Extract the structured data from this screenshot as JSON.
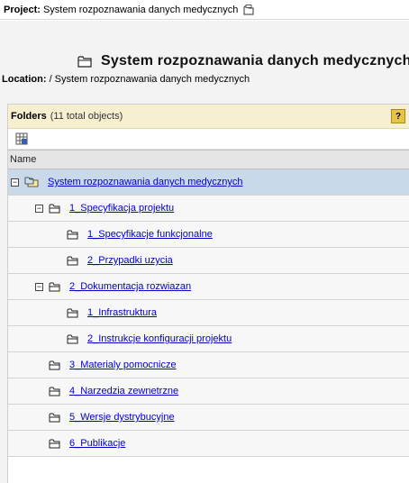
{
  "project": {
    "label": "Project:",
    "name": "System rozpoznawania danych medycznych"
  },
  "header": {
    "title": "System rozpoznawania danych medycznych"
  },
  "location": {
    "label": "Location:",
    "path": "/ System rozpoznawania danych medycznych"
  },
  "panel": {
    "title": "Folders",
    "count": "(11 total objects)",
    "help": "?"
  },
  "table": {
    "column_name": "Name"
  },
  "tree": [
    {
      "label": "System rozpoznawania danych medycznych",
      "toggle": "−"
    },
    {
      "label": "1_Specyfikacja projektu",
      "toggle": "−"
    },
    {
      "label": "1_Specyfikacje funkcjonalne"
    },
    {
      "label": "2_Przypadki uzycia"
    },
    {
      "label": "2_Dokumentacja rozwiazan",
      "toggle": "−"
    },
    {
      "label": "1_Infrastruktura"
    },
    {
      "label": "2_Instrukcje konfiguracji projektu"
    },
    {
      "label": "3_Materialy pomocnicze"
    },
    {
      "label": "4_Narzedzia zewnetrzne"
    },
    {
      "label": "5_Wersje dystrybucyjne"
    },
    {
      "label": "6_Publikacje"
    }
  ]
}
